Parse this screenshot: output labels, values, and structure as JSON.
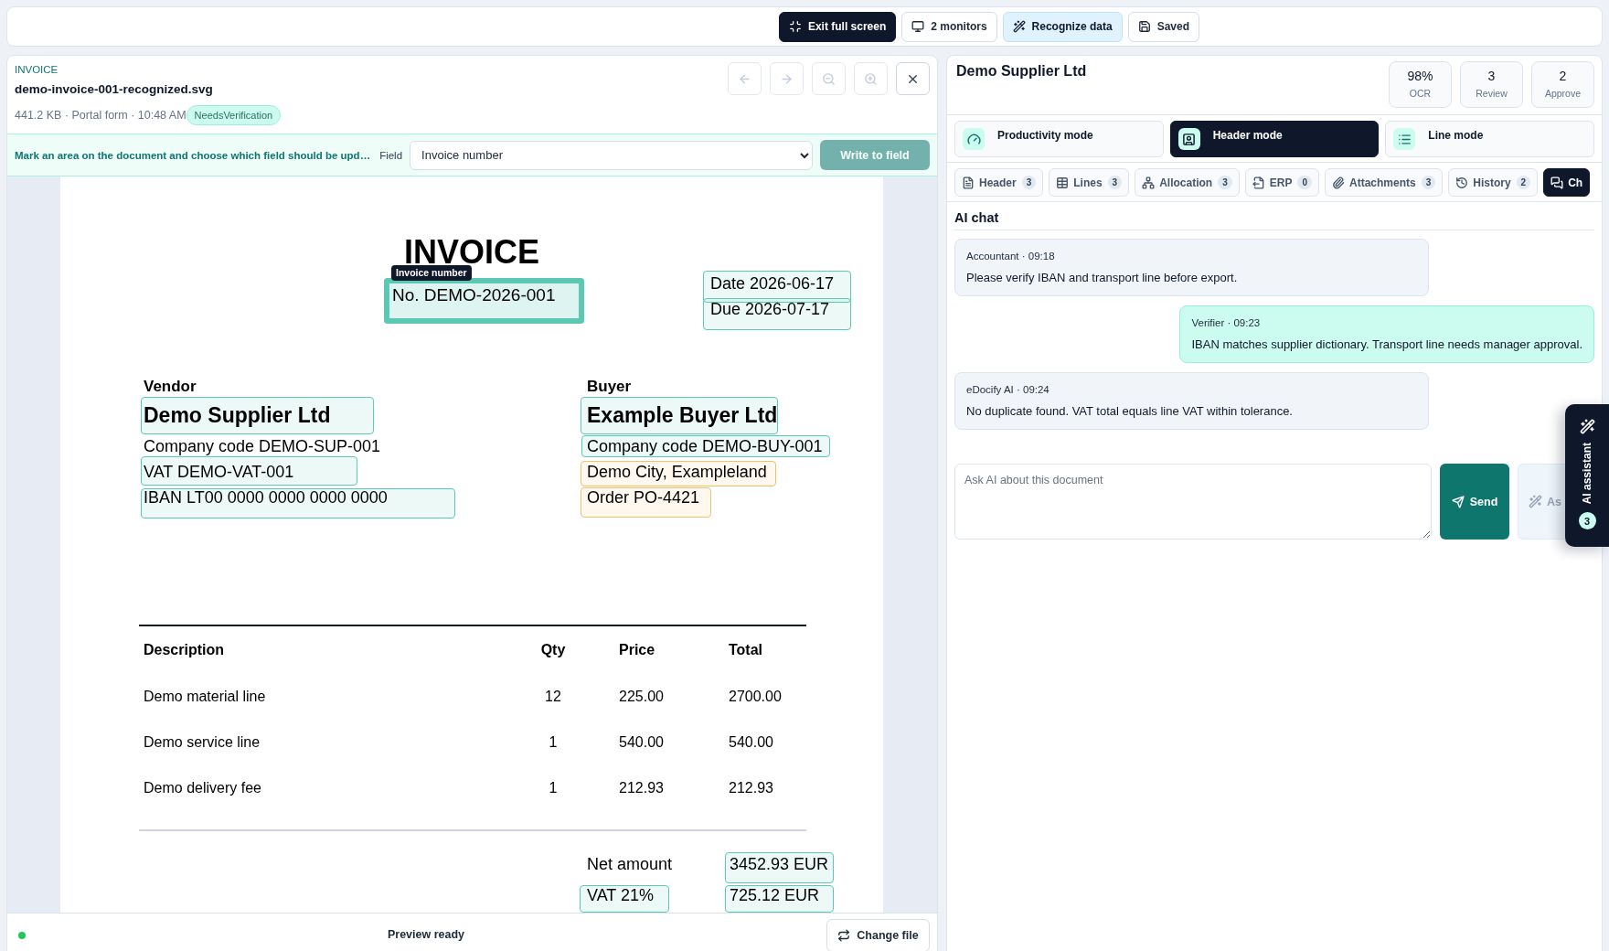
{
  "toolbar": [
    {
      "label": "Exit full screen",
      "kind": "dark"
    },
    {
      "label": "2 monitors",
      "kind": "plain"
    },
    {
      "label": "Recognize data",
      "kind": "tinted"
    },
    {
      "label": "Saved",
      "kind": "plain"
    }
  ],
  "viewer": {
    "type_label": "INVOICE",
    "file_name": "demo-invoice-001-recognized.svg",
    "meta": "441.2 KB · Portal form · 10:48 AM",
    "status_badge": "NeedsVerification",
    "nav_buttons": [
      {
        "disabled": true
      },
      {
        "disabled": true
      },
      {
        "disabled": true
      },
      {
        "disabled": true
      },
      {
        "disabled": false
      }
    ],
    "mark_bar": {
      "hint": "Mark an area on the document and choose which field should be upd…",
      "field_label": "Field",
      "field_value": "Invoice number",
      "button": {
        "label": "Write to field",
        "disabled": true
      }
    },
    "document": {
      "title": "INVOICE",
      "number": "No. DEMO-2026-001",
      "dates": [
        "Date 2026-06-17",
        "Due 2026-07-17"
      ],
      "parties": [
        {
          "heading": "Vendor",
          "name": "Demo Supplier Ltd",
          "details": [
            "Company code DEMO-SUP-001",
            "VAT DEMO-VAT-001",
            "IBAN LT00 0000 0000 0000 0000"
          ]
        },
        {
          "heading": "Buyer",
          "name": "Example Buyer Ltd",
          "details": [
            "Company code DEMO-BUY-001",
            "Demo City, Exampleland",
            "Order PO-4421"
          ]
        }
      ],
      "table": {
        "columns": [
          "Description",
          "Qty",
          "Price",
          "Total"
        ],
        "rows": [
          [
            "Demo material line",
            "12",
            "225.00",
            "2700.00"
          ],
          [
            "Demo service line",
            "1",
            "540.00",
            "540.00"
          ],
          [
            "Demo delivery fee",
            "1",
            "212.93",
            "212.93"
          ]
        ]
      },
      "totals": [
        {
          "label": "Net amount",
          "value": "3452.93 EUR"
        },
        {
          "label": "VAT 21%",
          "value": "725.12 EUR"
        }
      ],
      "highlights": [
        {
          "color": "#5cc9b5",
          "selected": true,
          "tag": "Invoice number"
        },
        {
          "color": "#5cc9b5",
          "selected": false
        },
        {
          "color": "#5cc9b5",
          "selected": false
        },
        {
          "color": "#5cc9b5",
          "selected": false
        },
        {
          "color": "#5cc9b5",
          "selected": false
        },
        {
          "color": "#5cc9b5",
          "selected": false
        },
        {
          "color": "#5cc9b5",
          "selected": false
        },
        {
          "color": "#5cc9b5",
          "selected": false
        },
        {
          "color": "#f4bf6e",
          "selected": false
        },
        {
          "color": "#f4bf6e",
          "selected": false
        },
        {
          "color": "#5cc9b5",
          "selected": false
        },
        {
          "color": "#5cc9b5",
          "selected": false
        },
        {
          "color": "#5cc9b5",
          "selected": false
        }
      ]
    },
    "footer": {
      "status": "Preview ready",
      "button": "Change file"
    }
  },
  "record": {
    "title": "Demo Supplier Ltd",
    "stats": [
      {
        "value": "98%",
        "label": "OCR"
      },
      {
        "value": "3",
        "label": "Review"
      },
      {
        "value": "2",
        "label": "Approve"
      }
    ],
    "modes": [
      {
        "label": "Productivity mode",
        "selected": false
      },
      {
        "label": "Header mode",
        "selected": true
      },
      {
        "label": "Line mode",
        "selected": false
      }
    ],
    "tabs": [
      {
        "label": "Header",
        "count": "3",
        "selected": false
      },
      {
        "label": "Lines",
        "count": "3",
        "selected": false
      },
      {
        "label": "Allocation",
        "count": "3",
        "selected": false
      },
      {
        "label": "ERP",
        "count": "0",
        "selected": false
      },
      {
        "label": "Attachments",
        "count": "3",
        "selected": false
      },
      {
        "label": "History",
        "count": "2",
        "selected": false
      },
      {
        "label": "Ch",
        "selected": true
      }
    ],
    "chat": {
      "title": "AI chat",
      "messages": [
        {
          "kind": "incoming",
          "meta": "Accountant · 09:18",
          "text": "Please verify IBAN and transport line before export."
        },
        {
          "kind": "outgoing",
          "meta": "Verifier · 09:23",
          "text": "IBAN matches supplier dictionary. Transport line needs manager approval."
        },
        {
          "kind": "incoming",
          "meta": "eDocify AI · 09:24",
          "text": "No duplicate found. VAT total equals line VAT within tolerance."
        }
      ],
      "input": {
        "placeholder": "Ask AI about this document"
      },
      "send_button": "Send",
      "ask_button": "As"
    }
  },
  "assistant_tab": {
    "label": "AI assistant",
    "count": "3"
  }
}
